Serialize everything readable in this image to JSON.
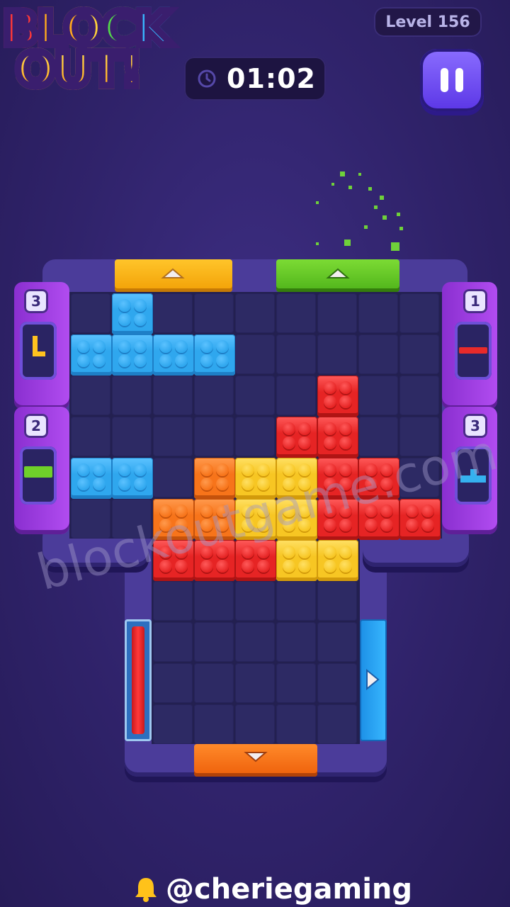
{
  "logo": {
    "line1": "BLOCK",
    "line2": "OUT!"
  },
  "level": {
    "label": "Level 156"
  },
  "timer": {
    "value": "01:02",
    "icon": "clock-icon"
  },
  "pause": {
    "icon": "pause-icon"
  },
  "counters": {
    "left_top": "3",
    "left_bottom": "2",
    "right_top": "1",
    "right_bottom": "3"
  },
  "watermark": "blockoutgame.com",
  "credit": {
    "handle": "@cheriegaming",
    "icon": "bell-icon"
  },
  "colors": {
    "blue": "#2fa7ee",
    "red": "#e62424",
    "orange": "#f7741a",
    "yellow": "#f7c623",
    "green": "#5fc21f",
    "purple": "#a746ea"
  }
}
